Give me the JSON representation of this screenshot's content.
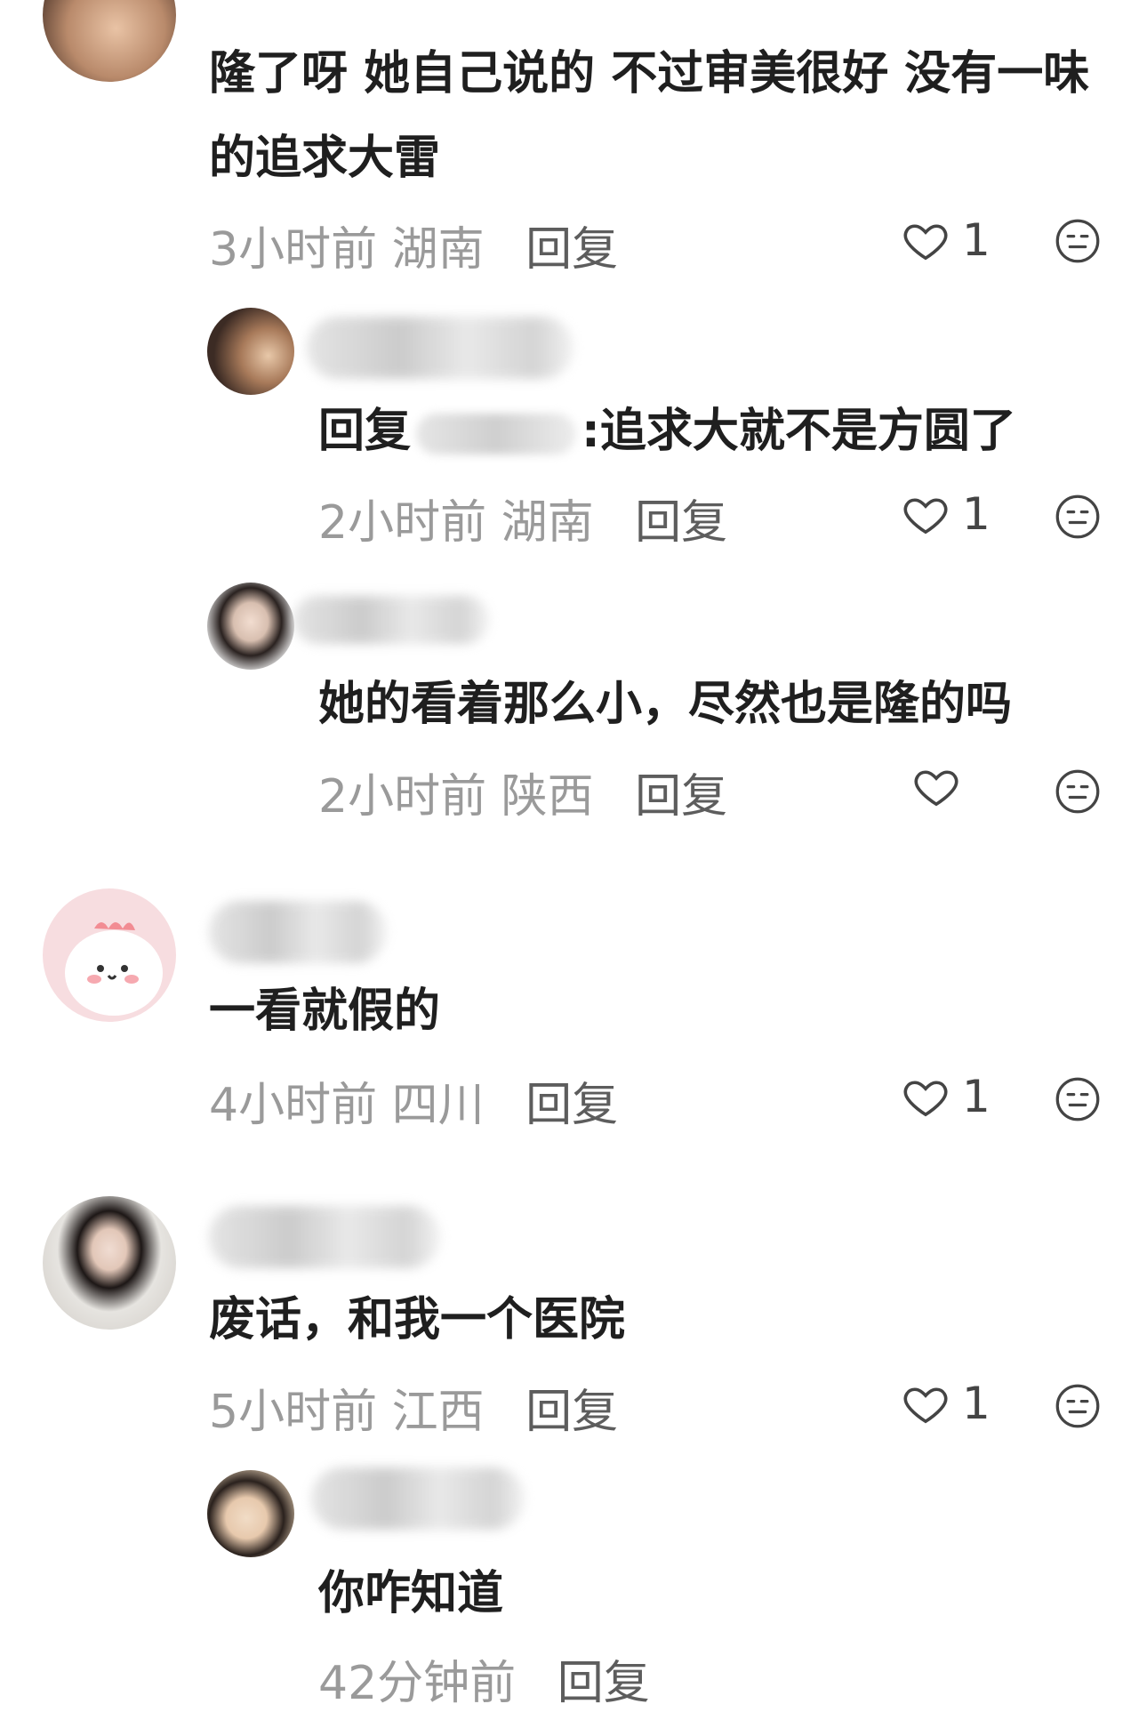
{
  "comments": [
    {
      "text": "隆了呀 她自己说的 不过审美很好 没有一味的追求大雷",
      "time": "3小时前",
      "region": "湖南",
      "reply": "回复",
      "likes": "1"
    },
    {
      "reply_prefix": "回复",
      "text": "追求大就不是方圆了",
      "time": "2小时前",
      "region": "湖南",
      "reply": "回复",
      "likes": "1"
    },
    {
      "text": "她的看着那么小，尽然也是隆的吗",
      "time": "2小时前",
      "region": "陕西",
      "reply": "回复",
      "likes": ""
    },
    {
      "text": "一看就假的",
      "time": "4小时前",
      "region": "四川",
      "reply": "回复",
      "likes": "1"
    },
    {
      "text": "废话，和我一个医院",
      "time": "5小时前",
      "region": "江西",
      "reply": "回复",
      "likes": "1"
    },
    {
      "text": "你咋知道",
      "time": "42分钟前",
      "region": "",
      "reply": "回复",
      "likes": ""
    }
  ],
  "icons": {
    "like": "heart-outline-icon",
    "dislike": "meh-face-icon"
  }
}
